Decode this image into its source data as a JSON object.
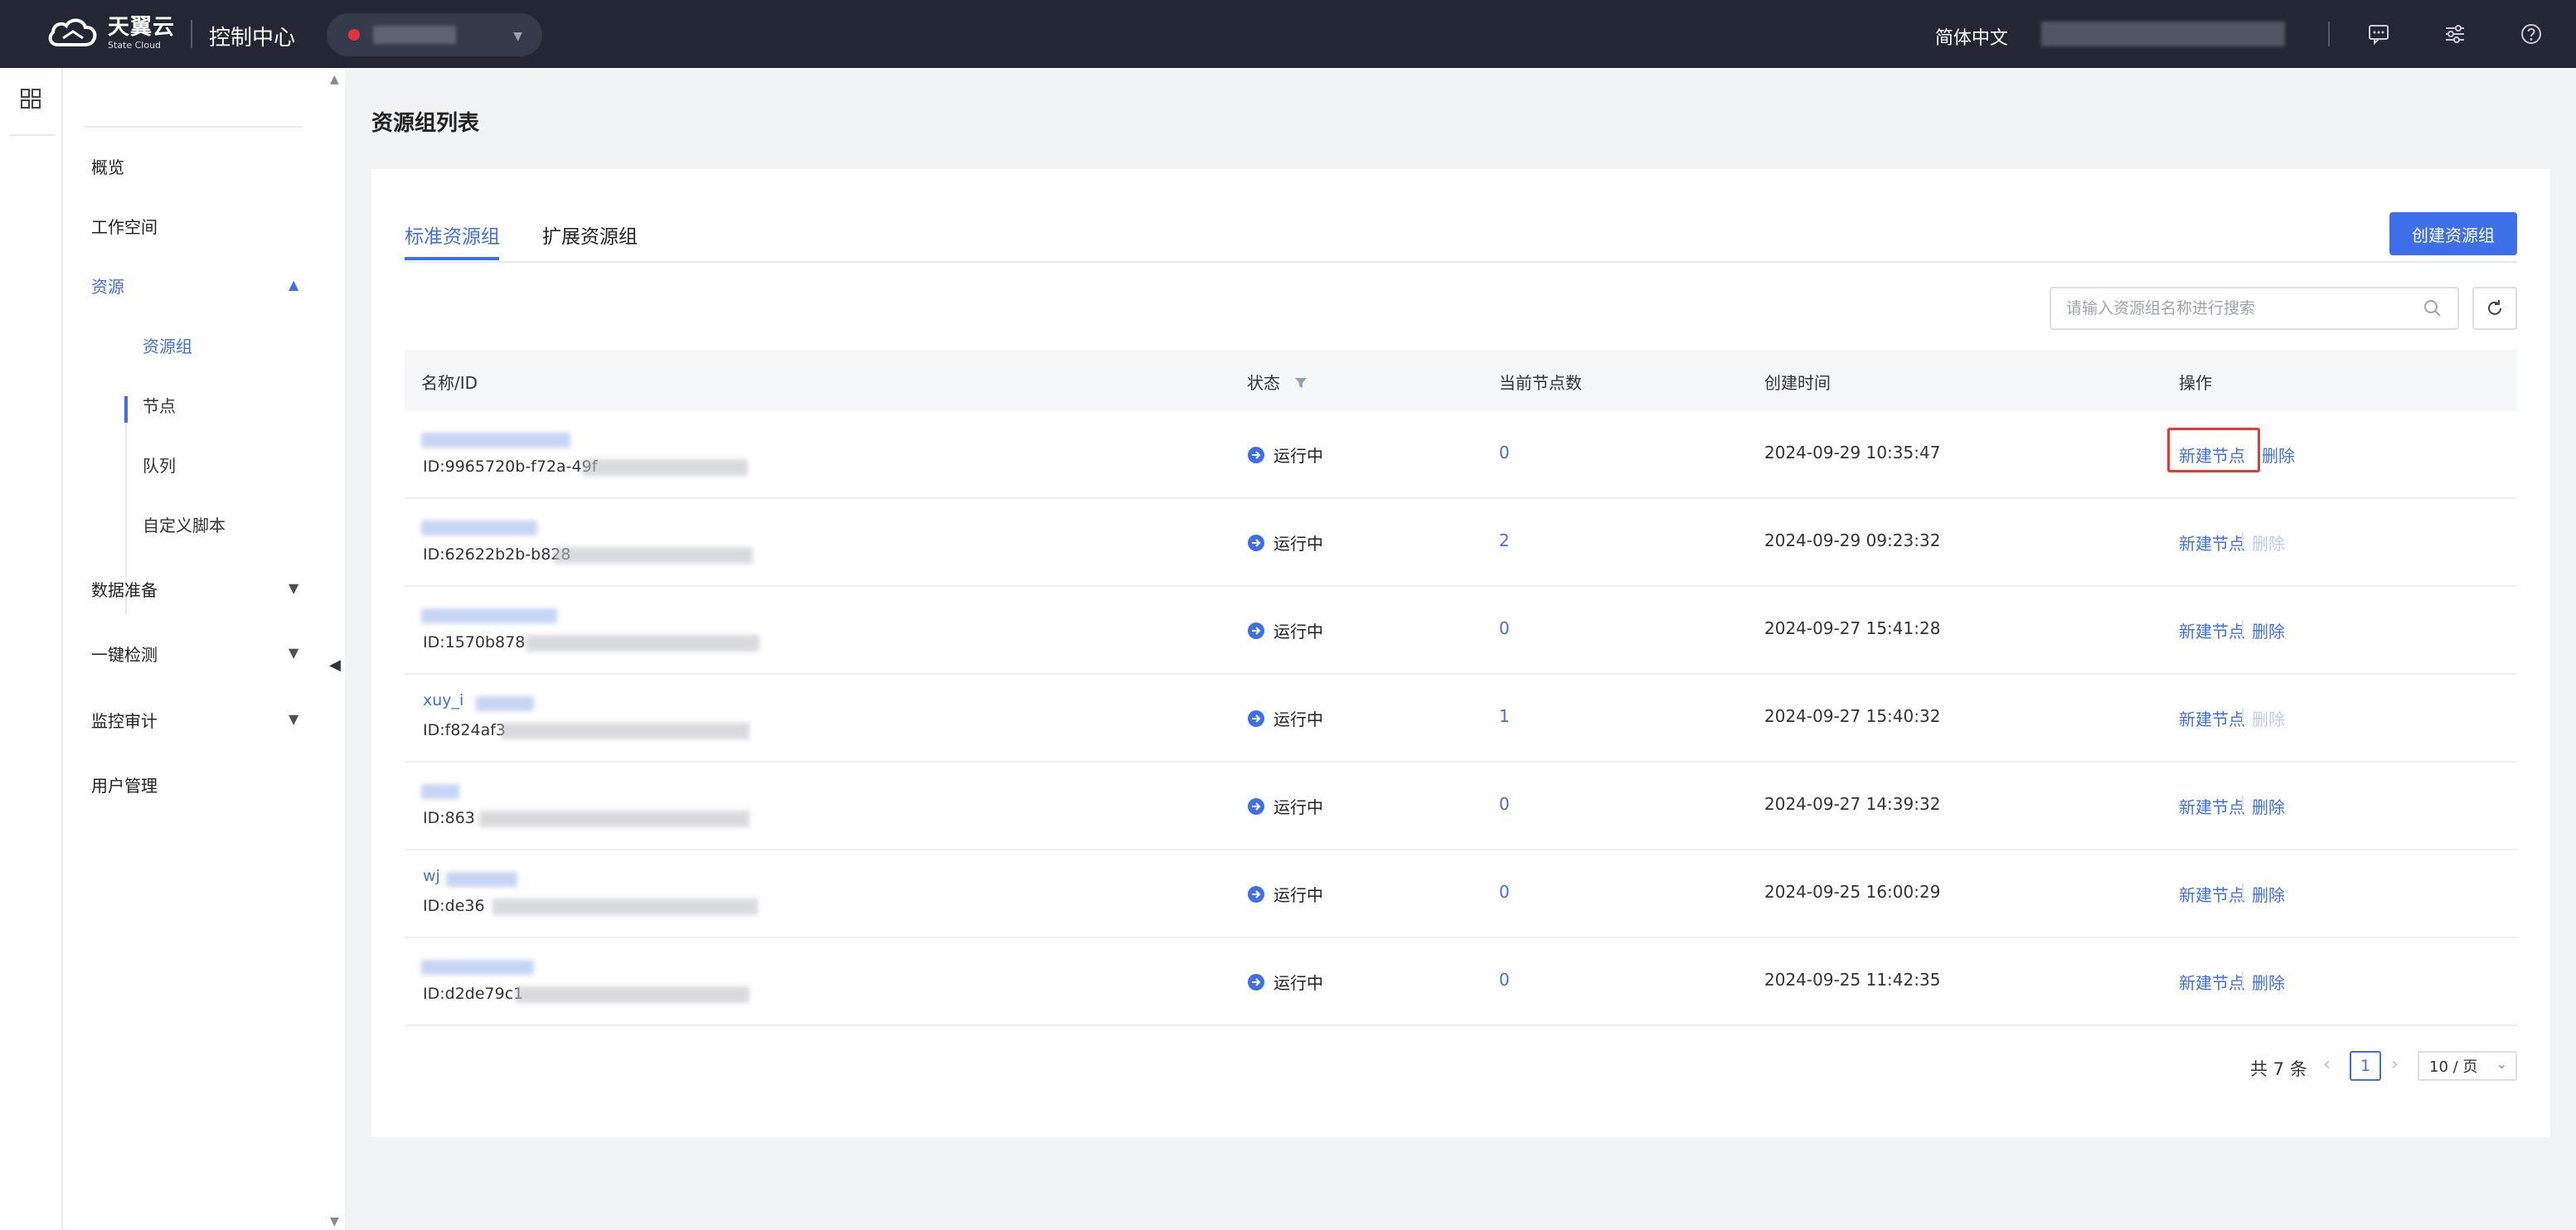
{
  "topbar": {
    "logo_cn": "天翼云",
    "logo_en": "State Cloud",
    "console_title": "控制中心",
    "language": "简体中文"
  },
  "sidebar": {
    "items": [
      {
        "label": "概览"
      },
      {
        "label": "工作空间"
      },
      {
        "label": "资源"
      },
      {
        "label": "数据准备"
      },
      {
        "label": "一键检测"
      },
      {
        "label": "监控审计"
      },
      {
        "label": "用户管理"
      }
    ],
    "resource_sub": [
      {
        "label": "资源组"
      },
      {
        "label": "节点"
      },
      {
        "label": "队列"
      },
      {
        "label": "自定义脚本"
      }
    ]
  },
  "main": {
    "page_title": "资源组列表",
    "tabs": [
      {
        "label": "标准资源组"
      },
      {
        "label": "扩展资源组"
      }
    ],
    "create_button": "创建资源组",
    "search_placeholder": "请输入资源组名称进行搜索",
    "table": {
      "headers": {
        "name": "名称/ID",
        "status": "状态",
        "nodes": "当前节点数",
        "created": "创建时间",
        "actions": "操作"
      },
      "rows": [
        {
          "name": "",
          "id": "ID:9965720b-f72a-49f",
          "status": "运行中",
          "nodes": "0",
          "created": "2024-09-29 10:35:47",
          "new_node": "新建节点",
          "delete": "删除"
        },
        {
          "name": "",
          "id": "ID:62622b2b-b828",
          "status": "运行中",
          "nodes": "2",
          "created": "2024-09-29 09:23:32",
          "new_node": "新建节点",
          "delete": "删除"
        },
        {
          "name": "",
          "id": "ID:1570b878",
          "status": "运行中",
          "nodes": "0",
          "created": "2024-09-27 15:41:28",
          "new_node": "新建节点",
          "delete": "删除"
        },
        {
          "name": "xuy_i",
          "id": "ID:f824af3",
          "status": "运行中",
          "nodes": "1",
          "created": "2024-09-27 15:40:32",
          "new_node": "新建节点",
          "delete": "删除"
        },
        {
          "name": "",
          "id": "ID:863",
          "status": "运行中",
          "nodes": "0",
          "created": "2024-09-27 14:39:32",
          "new_node": "新建节点",
          "delete": "删除"
        },
        {
          "name": "wj",
          "id": "ID:de36",
          "status": "运行中",
          "nodes": "0",
          "created": "2024-09-25 16:00:29",
          "new_node": "新建节点",
          "delete": "删除"
        },
        {
          "name": "",
          "id": "ID:d2de79c1",
          "status": "运行中",
          "nodes": "0",
          "created": "2024-09-25 11:42:35",
          "new_node": "新建节点",
          "delete": "删除"
        }
      ]
    },
    "pagination": {
      "total": "共 7 条",
      "current_page": "1",
      "page_size": "10 / 页"
    }
  },
  "colors": {
    "accent": "#3f6fe8",
    "topbar": "#232733",
    "highlight": "#e53935"
  },
  "icons": [
    "cloud-logo-icon",
    "chat-icon",
    "settings-sliders-icon",
    "help-icon",
    "grid-icon",
    "search-icon",
    "refresh-icon",
    "filter-icon",
    "running-status-icon"
  ]
}
